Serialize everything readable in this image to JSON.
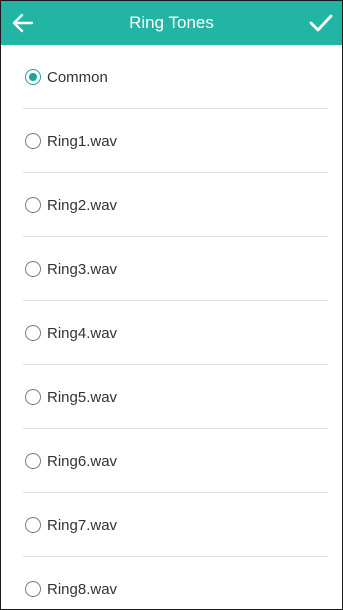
{
  "header": {
    "title": "Ring Tones",
    "back_icon": "arrow-left-icon",
    "confirm_icon": "checkmark-icon",
    "background_color": "#23b5a4",
    "accent_color": "#1aa596"
  },
  "ringtones": {
    "selected": "Common",
    "items": [
      {
        "label": "Common",
        "checked": true
      },
      {
        "label": "Ring1.wav",
        "checked": false
      },
      {
        "label": "Ring2.wav",
        "checked": false
      },
      {
        "label": "Ring3.wav",
        "checked": false
      },
      {
        "label": "Ring4.wav",
        "checked": false
      },
      {
        "label": "Ring5.wav",
        "checked": false
      },
      {
        "label": "Ring6.wav",
        "checked": false
      },
      {
        "label": "Ring7.wav",
        "checked": false
      },
      {
        "label": "Ring8.wav",
        "checked": false
      }
    ]
  }
}
